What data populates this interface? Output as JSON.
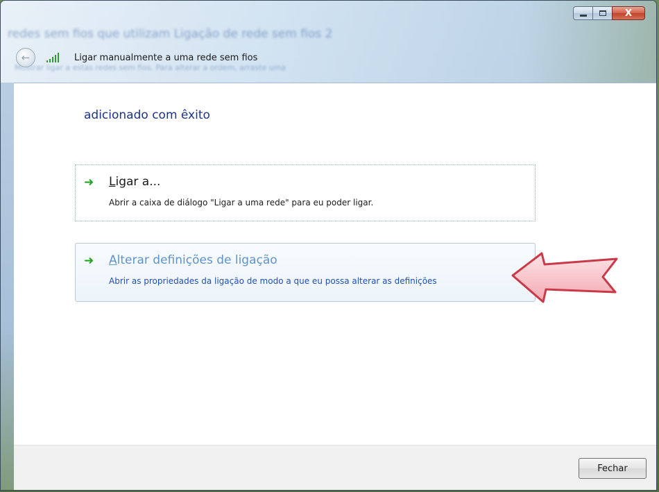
{
  "window": {
    "background_blur_text": "redes sem fios que utilizam Ligação de rede sem fios 2",
    "background_blur_text2": "Mostrar ligar a estas redes sem fios. Para alterar a ordem, arraste uma",
    "nav_title": "Ligar manualmente a uma rede sem fios",
    "caption_close": "X"
  },
  "content": {
    "heading": "adicionado com êxito",
    "options": [
      {
        "title_first_letter": "L",
        "title_rest": "igar a...",
        "description": "Abrir a caixa de diálogo \"Ligar a uma rede\" para eu poder ligar."
      },
      {
        "title_first_letter": "A",
        "title_rest": "lterar definições de ligação",
        "description": "Abrir as propriedades da ligação de modo a que eu possa alterar as definições"
      }
    ]
  },
  "footer": {
    "close_label": "Fechar"
  },
  "colors": {
    "heading": "#1e3287",
    "link_hover": "#5f92c8",
    "description_hover": "#1f4fb0",
    "arrow_green": "#23a623",
    "pointer_arrow_fill": "#f6c1c6",
    "pointer_arrow_stroke": "#c83a4a"
  },
  "icons": [
    "back-arrow-icon",
    "wireless-signal-icon",
    "green-arrow-icon",
    "red-pointer-arrow-icon"
  ]
}
